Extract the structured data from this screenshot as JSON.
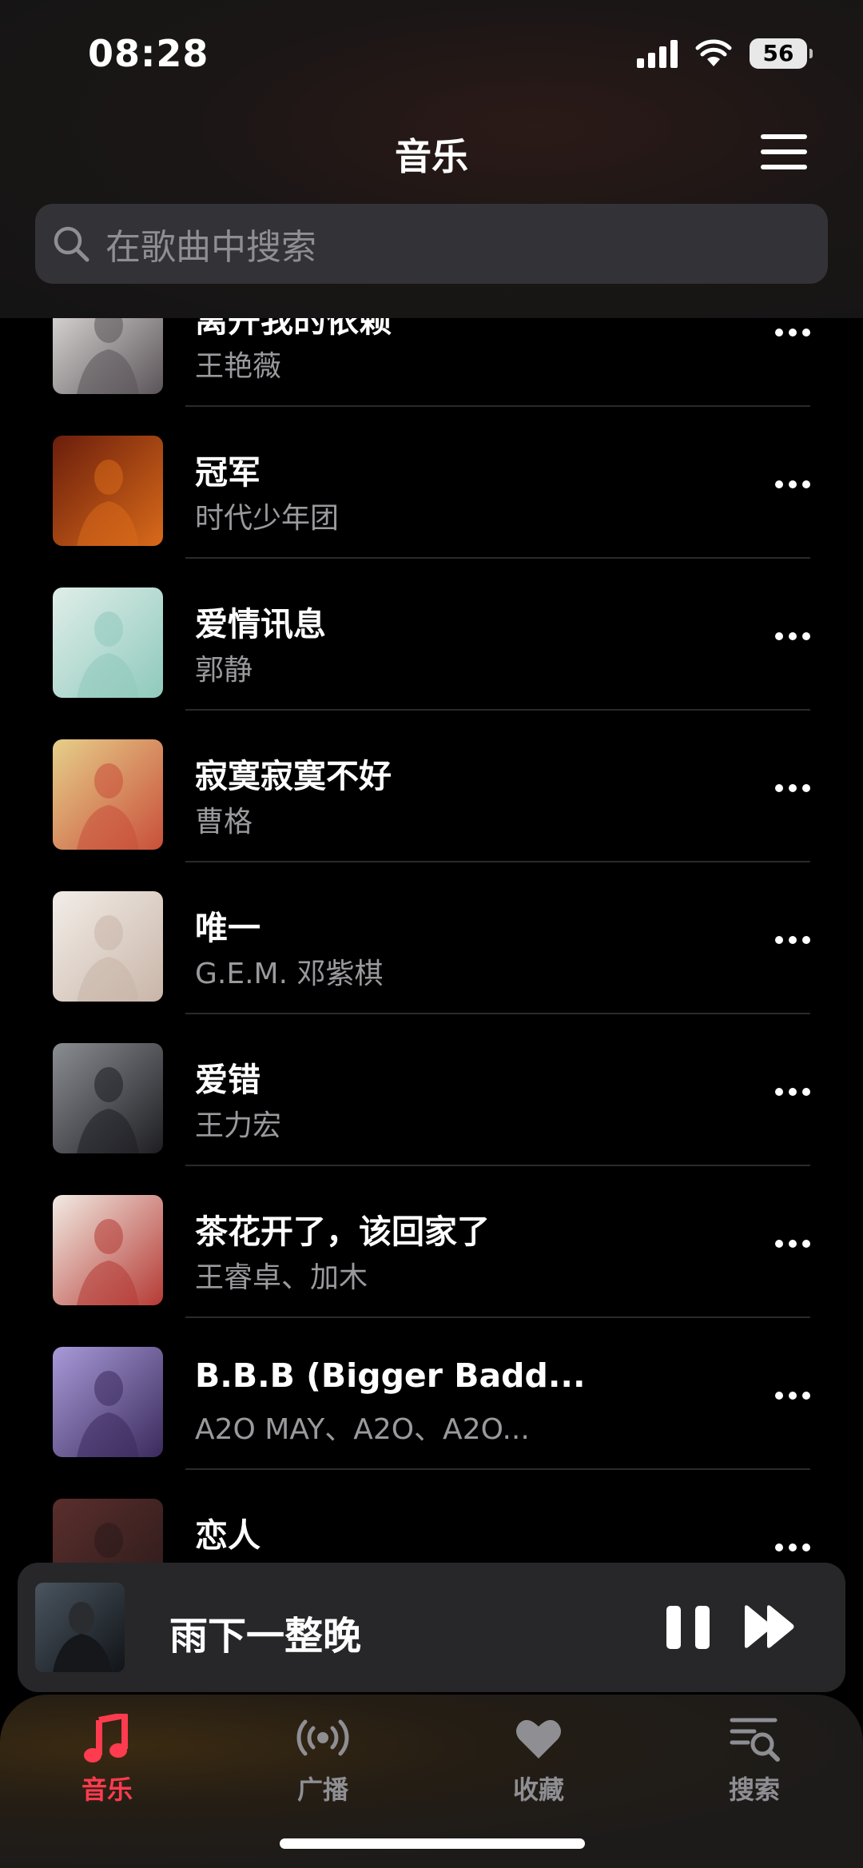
{
  "status_bar": {
    "time": "08:28",
    "battery": "56"
  },
  "header": {
    "title": "音乐"
  },
  "search": {
    "placeholder": "在歌曲中搜索"
  },
  "songs": [
    {
      "title": "离开我的依赖",
      "artist": "王艳薇",
      "cover_colors": [
        "#e9e6e4",
        "#5a5458"
      ]
    },
    {
      "title": "冠军",
      "artist": "时代少年团",
      "cover_colors": [
        "#6b1e0c",
        "#d96a1a"
      ]
    },
    {
      "title": "爱情讯息",
      "artist": "郭静",
      "cover_colors": [
        "#dfeee8",
        "#8fc9bd"
      ]
    },
    {
      "title": "寂寞寂寞不好",
      "artist": "曹格",
      "cover_colors": [
        "#e6cf8a",
        "#c94f3a"
      ]
    },
    {
      "title": "唯一",
      "artist": "G.E.M. 邓紫棋",
      "cover_colors": [
        "#f2ede8",
        "#c9b5a8"
      ]
    },
    {
      "title": "爱错",
      "artist": "王力宏",
      "cover_colors": [
        "#8a8d92",
        "#1e1e22"
      ]
    },
    {
      "title": "茶花开了，该回家了",
      "artist": "王睿卓、加木",
      "cover_colors": [
        "#f1ebe3",
        "#b53a34"
      ]
    },
    {
      "title": "B.B.B (Bigger Badd...",
      "artist": "A2O MAY、A2O、A2O...",
      "cover_colors": [
        "#a89ad8",
        "#3a2a5c"
      ]
    },
    {
      "title": "恋人",
      "artist": "",
      "cover_colors": [
        "#5a2e2c",
        "#2a1a1a"
      ]
    }
  ],
  "mini_player": {
    "title": "雨下一整晚"
  },
  "tabs": [
    {
      "label": "音乐",
      "icon": "music-note-icon",
      "active": true
    },
    {
      "label": "广播",
      "icon": "broadcast-icon",
      "active": false
    },
    {
      "label": "收藏",
      "icon": "heart-icon",
      "active": false
    },
    {
      "label": "搜索",
      "icon": "search-list-icon",
      "active": false
    }
  ],
  "colors": {
    "accent": "#ff3b4f",
    "background": "#000000",
    "secondary_text": "#9a9a9e"
  }
}
